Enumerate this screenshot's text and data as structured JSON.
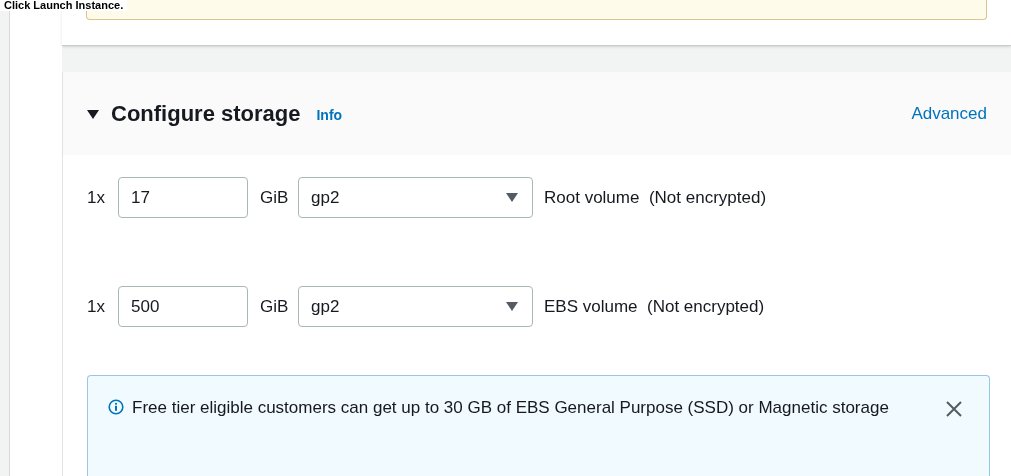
{
  "instruction": "Click Launch Instance.",
  "storage": {
    "title": "Configure storage",
    "expanded": true,
    "info_link": "Info",
    "advanced_link": "Advanced",
    "volumes": [
      {
        "count": "1x",
        "size": "17",
        "unit": "GiB",
        "type": "gp2",
        "label": "Root volume",
        "encryption": "(Not encrypted)"
      },
      {
        "count": "1x",
        "size": "500",
        "unit": "GiB",
        "type": "gp2",
        "label": "EBS volume",
        "encryption": "(Not encrypted)"
      }
    ],
    "notice": {
      "text": "Free tier eligible customers can get up to 30 GB of EBS General Purpose (SSD) or Magnetic storage"
    }
  }
}
